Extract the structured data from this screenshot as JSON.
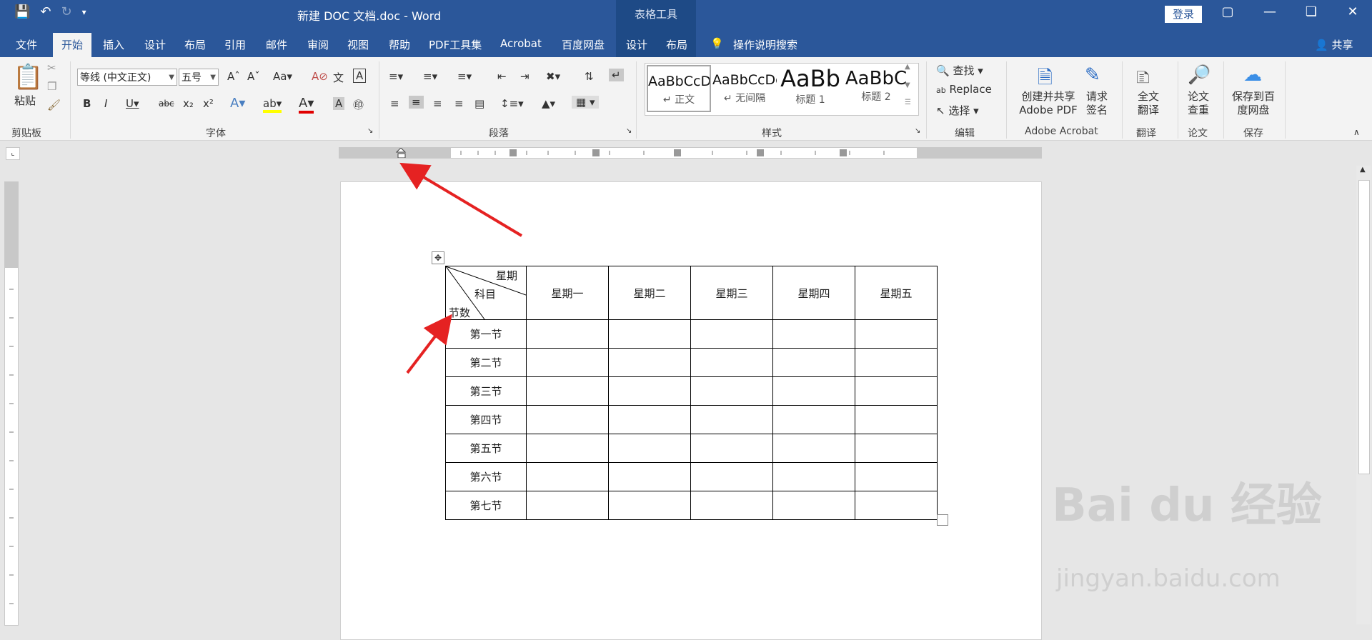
{
  "titlebar": {
    "title": "新建 DOC 文档.doc - Word",
    "context_label": "表格工具",
    "login": "登录"
  },
  "tabs": [
    "文件",
    "开始",
    "插入",
    "设计",
    "布局",
    "引用",
    "邮件",
    "审阅",
    "视图",
    "帮助",
    "PDF工具集",
    "Acrobat",
    "百度网盘",
    "设计",
    "布局",
    "操作说明搜索"
  ],
  "share": "共享",
  "ribbon": {
    "clipboard": {
      "paste": "粘贴",
      "group": "剪贴板"
    },
    "font": {
      "name": "等线 (中文正文)",
      "size": "五号",
      "group": "字体"
    },
    "paragraph": {
      "group": "段落"
    },
    "styles": {
      "group": "样式",
      "items": [
        {
          "sample": "AaBbCcDc",
          "name": "↵ 正文"
        },
        {
          "sample": "AaBbCcDc",
          "name": "↵ 无间隔"
        },
        {
          "sample": "AaBb",
          "name": "标题 1"
        },
        {
          "sample": "AaBbC",
          "name": "标题 2"
        }
      ]
    },
    "editing": {
      "find": "查找",
      "replace": "Replace",
      "select": "选择",
      "group": "编辑"
    },
    "acrobat": {
      "create": "创建并共享 Adobe PDF",
      "sign": "请求签名",
      "group": "Adobe Acrobat"
    },
    "translate": {
      "label": "全文翻译",
      "group": "翻译"
    },
    "paper": {
      "label": "论文查重",
      "group": "论文"
    },
    "save": {
      "label": "保存到百度网盘",
      "group": "保存"
    }
  },
  "table": {
    "diag_labels": [
      "星期",
      "科目",
      "节数"
    ],
    "headers": [
      "星期一",
      "星期二",
      "星期三",
      "星期四",
      "星期五"
    ],
    "rows": [
      "第一节",
      "第二节",
      "第三节",
      "第四节",
      "第五节",
      "第六节",
      "第七节"
    ]
  },
  "watermark": {
    "main": "Bai du 经验",
    "sub": "jingyan.baidu.com"
  }
}
